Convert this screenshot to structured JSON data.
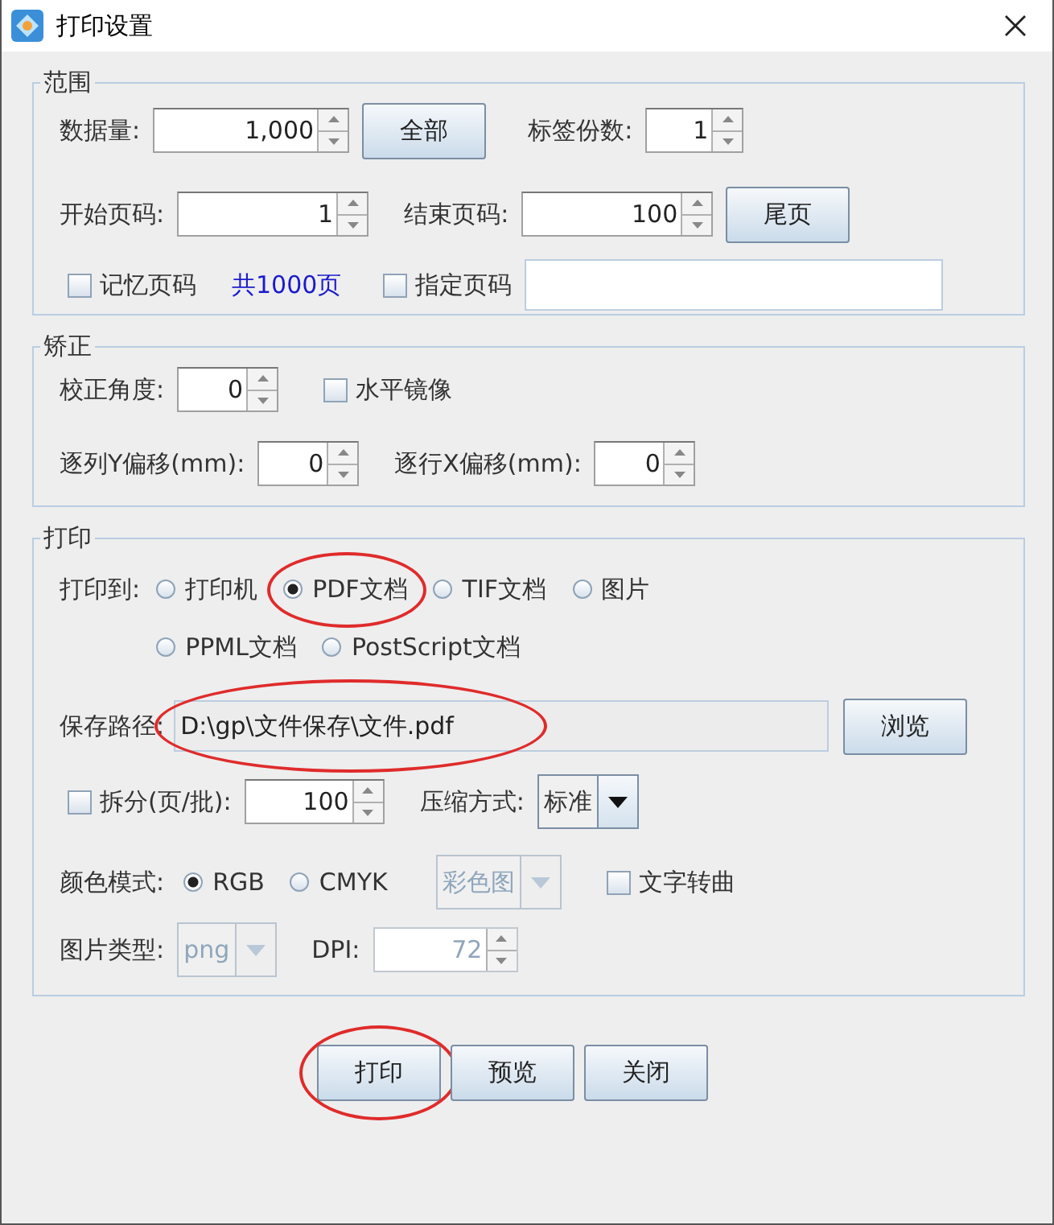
{
  "window": {
    "title": "打印设置"
  },
  "range": {
    "legend": "范围",
    "data_count": {
      "label": "数据量:",
      "value": "1,000"
    },
    "all_button": "全部",
    "copies": {
      "label": "标签份数:",
      "value": "1"
    },
    "start_page": {
      "label": "开始页码:",
      "value": "1"
    },
    "end_page": {
      "label": "结束页码:",
      "value": "100"
    },
    "last_button": "尾页",
    "remember_pages": {
      "label": "记忆页码",
      "checked": false
    },
    "total": "共1000页",
    "specify_pages": {
      "label": "指定页码",
      "checked": false
    }
  },
  "correction": {
    "legend": "矫正",
    "angle": {
      "label": "校正角度:",
      "value": "0"
    },
    "mirror": {
      "label": "水平镜像",
      "checked": false
    },
    "column_offset": {
      "label": "逐列Y偏移(mm):",
      "value": "0"
    },
    "row_offset": {
      "label": "逐行X偏移(mm):",
      "value": "0"
    }
  },
  "print": {
    "legend": "打印",
    "target_label": "打印到:",
    "target_rows": [
      [
        {
          "label": "打印机",
          "selected": false,
          "highlighted": false
        },
        {
          "label": "PDF文档",
          "selected": true,
          "highlighted": true
        },
        {
          "label": "TIF文档",
          "selected": false,
          "highlighted": false
        },
        {
          "label": "图片",
          "selected": false,
          "highlighted": false
        }
      ],
      [
        {
          "label": "PPML文档",
          "selected": false,
          "highlighted": false
        },
        {
          "label": "PostScript文档",
          "selected": false,
          "highlighted": false
        }
      ]
    ],
    "save_path": {
      "label": "保存路径:",
      "value": "D:\\gp\\文件保存\\文件.pdf",
      "highlighted": true
    },
    "browse_button": "浏览",
    "split": {
      "label": "拆分(页/批):",
      "checked": false,
      "value": "100"
    },
    "compression": {
      "label": "压缩方式:",
      "value": "标准"
    },
    "color_mode": {
      "label": "颜色模式:",
      "options": [
        {
          "label": "RGB",
          "selected": true
        },
        {
          "label": "CMYK",
          "selected": false
        }
      ]
    },
    "color_dropdown": {
      "value": "彩色图",
      "disabled": true
    },
    "text_to_curve": {
      "label": "文字转曲",
      "checked": false
    },
    "image_type": {
      "label": "图片类型:",
      "value": "png",
      "disabled": true
    },
    "dpi": {
      "label": "DPI:",
      "value": "72",
      "disabled": true
    }
  },
  "buttons": [
    {
      "label": "打印",
      "highlighted": true
    },
    {
      "label": "预览",
      "highlighted": false
    },
    {
      "label": "关闭",
      "highlighted": false
    }
  ]
}
